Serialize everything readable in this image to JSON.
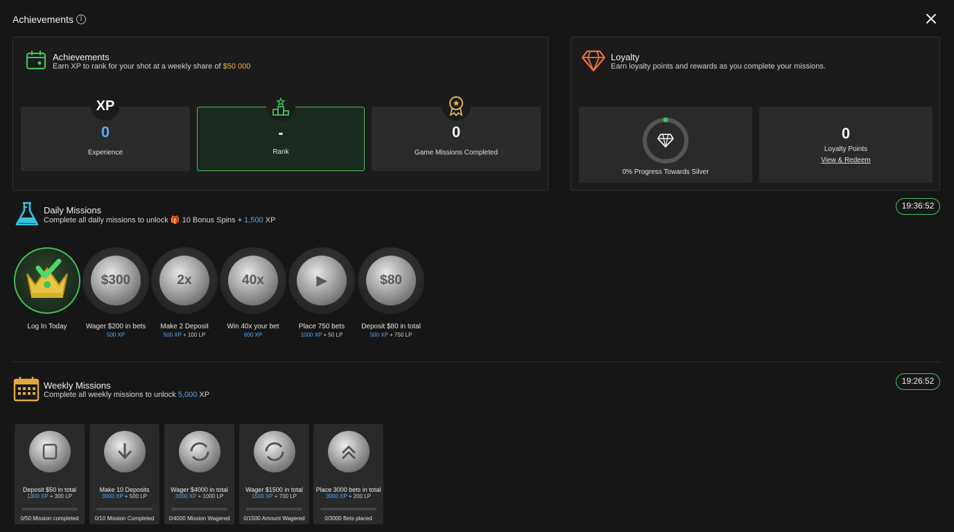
{
  "header": {
    "title": "Achievements"
  },
  "achievements": {
    "title": "Achievements",
    "subtitle_prefix": "Earn XP to rank for your shot at a weekly share of ",
    "subtitle_amount": "$50 000",
    "stats": [
      {
        "value": "0",
        "label": "Experience",
        "badge": "XP"
      },
      {
        "value": "-",
        "label": "Rank"
      },
      {
        "value": "0",
        "label": "Game Missions Completed"
      }
    ]
  },
  "loyalty": {
    "title": "Loyalty",
    "subtitle": "Earn loyalty points and rewards as you complete your missions.",
    "progress_label": "0% Progress Towards Silver",
    "progress": 0,
    "points_value": "0",
    "points_label": "Loyalty Points",
    "redeem_link": "View & Redeem"
  },
  "daily": {
    "title": "Daily Missions",
    "subtitle_prefix": "Complete all daily missions to unlock ",
    "subtitle_spins": "10 Bonus Spins + ",
    "subtitle_xp": "1,500",
    "subtitle_xp_unit": " XP",
    "timer": "19:36:52",
    "missions": [
      {
        "name": "Log In Today",
        "xp": "",
        "rest": "",
        "icon_text": "",
        "completed": true
      },
      {
        "name": "Wager $200 in bets",
        "xp": "500 XP",
        "rest": "",
        "icon_text": "$300",
        "completed": false
      },
      {
        "name": "Make 2 Deposit",
        "xp": "500 XP",
        "rest": " + 100 LP",
        "icon_text": "2x",
        "completed": false
      },
      {
        "name": "Win 40x your bet",
        "xp": "600 XP",
        "rest": "",
        "icon_text": "40x",
        "completed": false
      },
      {
        "name": "Place 750 bets",
        "xp": "1000 XP",
        "rest": " + 50 LP",
        "icon_text": "▶",
        "completed": false
      },
      {
        "name": "Deposit $80 in total",
        "xp": "500 XP",
        "rest": " + 750 LP",
        "icon_text": "$80",
        "completed": false
      }
    ]
  },
  "weekly": {
    "title": "Weekly Missions",
    "subtitle_prefix": "Complete all weekly missions to unlock ",
    "subtitle_xp": "5,000",
    "subtitle_xp_unit": " XP",
    "timer": "19:26:52",
    "missions": [
      {
        "name": "Deposit $50 in total",
        "xp": "1300 XP",
        "rest": " + 300 LP",
        "progress": "0/50 Mission completed",
        "progress_value": 0
      },
      {
        "name": "Make 10 Deposits",
        "xp": "3000 XP",
        "rest": " + 500 LP",
        "progress": "0/10 Mission Completed",
        "progress_value": 0
      },
      {
        "name": "Wager $4000 in total",
        "xp": "3000 XP",
        "rest": " + 1000 LP",
        "progress": "0/4000 Mission Wagered",
        "progress_value": 0
      },
      {
        "name": "Wager $1500 in total",
        "xp": "1500 XP",
        "rest": " + 700 LP",
        "progress": "0/1500 Amount Wagered",
        "progress_value": 0
      },
      {
        "name": "Place 3000 bets in total",
        "xp": "3000 XP",
        "rest": " + 200 LP",
        "progress": "0/3000 Bets placed",
        "progress_value": 0
      }
    ]
  },
  "colors": {
    "accent_green": "#3ec45a",
    "xp_blue": "#59a6f5",
    "gold": "#e2b455",
    "diamond_orange": "#f0703a"
  }
}
